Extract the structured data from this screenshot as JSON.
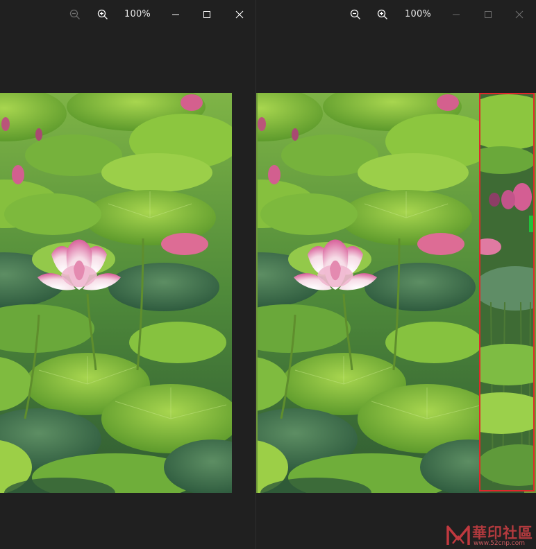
{
  "left_window": {
    "zoom_level": "100%",
    "icons": {
      "zoom_out": "zoom-out-icon",
      "zoom_in": "zoom-in-icon",
      "minimize": "minimize-icon",
      "maximize": "maximize-icon",
      "close": "close-icon"
    }
  },
  "right_window": {
    "zoom_level": "100%",
    "icons": {
      "zoom_out": "zoom-out-icon",
      "zoom_in": "zoom-in-icon",
      "minimize": "minimize-icon",
      "maximize": "maximize-icon",
      "close": "close-icon"
    },
    "selection_color": "#e0282b"
  },
  "watermark": {
    "main": "華印社區",
    "sub": "www.52cnp.com"
  },
  "colors": {
    "background": "#1f1f1f",
    "accent_selection": "#e0282b"
  }
}
